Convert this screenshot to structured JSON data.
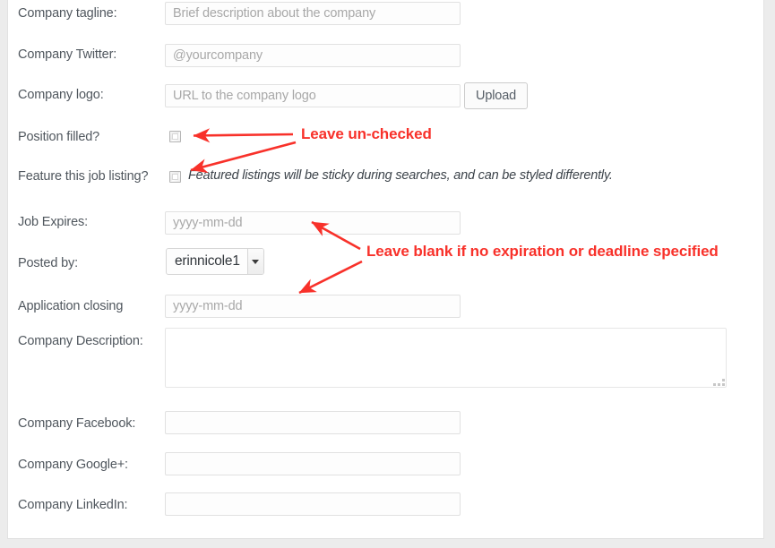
{
  "form": {
    "fields": [
      {
        "label": "Company tagline:",
        "placeholder": "Brief description about the company",
        "value": ""
      },
      {
        "label": "Company Twitter:",
        "placeholder": "@yourcompany",
        "value": ""
      },
      {
        "label": "Company logo:",
        "placeholder": "URL to the company logo",
        "value": ""
      },
      {
        "label": "Position filled?",
        "placeholder": "",
        "value": ""
      },
      {
        "label": "Feature this job listing?",
        "placeholder": "",
        "value": ""
      },
      {
        "label": "Job Expires:",
        "placeholder": "yyyy-mm-dd",
        "value": ""
      },
      {
        "label": "Posted by:",
        "placeholder": "",
        "value": ""
      },
      {
        "label": "Application closing",
        "placeholder": "yyyy-mm-dd",
        "value": ""
      },
      {
        "label": "Company Description:",
        "placeholder": "",
        "value": ""
      },
      {
        "label": "Company Facebook:",
        "placeholder": "",
        "value": ""
      },
      {
        "label": "Company Google+:",
        "placeholder": "",
        "value": ""
      },
      {
        "label": "Company LinkedIn:",
        "placeholder": "",
        "value": ""
      }
    ],
    "upload_button": "Upload",
    "feature_hint": "Featured listings will be sticky during searches, and can be styled differently.",
    "posted_by": {
      "selected": "erinnicole1",
      "options": [
        "erinnicole1"
      ]
    },
    "position_filled_checked": false,
    "feature_listing_checked": false
  },
  "annotations": [
    {
      "text": "Leave un-checked"
    },
    {
      "text": "Leave blank if no expiration or deadline specified"
    }
  ],
  "colors": {
    "annotation_red": "#f8312a",
    "label_gray": "#50575e",
    "placeholder_gray": "#a8a8a8",
    "page_background": "#ececec",
    "panel_background": "#ffffff",
    "input_border": "#e1e1e1"
  }
}
